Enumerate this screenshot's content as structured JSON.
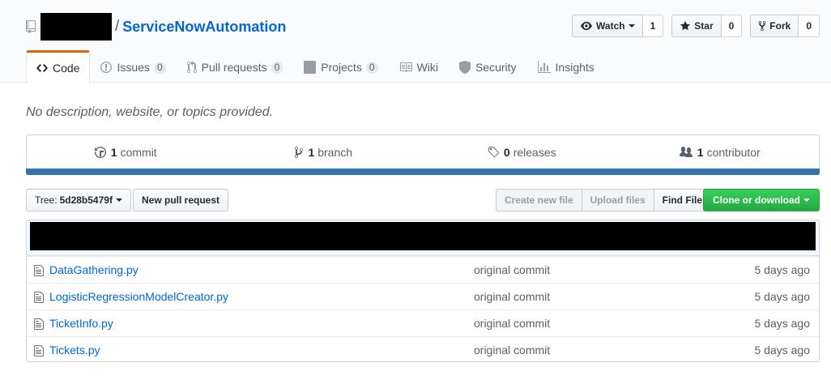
{
  "repo": {
    "name": "ServiceNowAutomation",
    "separator": "/"
  },
  "actions": {
    "watch": {
      "label": "Watch",
      "count": "1"
    },
    "star": {
      "label": "Star",
      "count": "0"
    },
    "fork": {
      "label": "Fork",
      "count": "0"
    }
  },
  "nav": {
    "tabs": [
      {
        "label": "Code",
        "icon": "code-icon",
        "selected": true
      },
      {
        "label": "Issues",
        "counter": "0",
        "icon": "issue-icon"
      },
      {
        "label": "Pull requests",
        "counter": "0",
        "icon": "pull-request-icon"
      },
      {
        "label": "Projects",
        "counter": "0",
        "icon": "project-icon"
      },
      {
        "label": "Wiki",
        "icon": "book-icon"
      },
      {
        "label": "Security",
        "icon": "shield-icon"
      },
      {
        "label": "Insights",
        "icon": "graph-icon"
      }
    ]
  },
  "description": "No description, website, or topics provided.",
  "summary": {
    "commits": {
      "num": "1",
      "label": "commit"
    },
    "branches": {
      "num": "1",
      "label": "branch"
    },
    "releases": {
      "num": "0",
      "label": "releases"
    },
    "contributors": {
      "num": "1",
      "label": "contributor"
    },
    "language_color": "#3572a5"
  },
  "file_nav": {
    "tree_label": "Tree:",
    "tree_ref": "5d28b5479f",
    "new_pr": "New pull request",
    "create_file": "Create new file",
    "upload_files": "Upload files",
    "find_file": "Find File",
    "clone": "Clone or download"
  },
  "files": [
    {
      "name": "DataGathering.py",
      "message": "original commit",
      "age": "5 days ago"
    },
    {
      "name": "LogisticRegressionModelCreator.py",
      "message": "original commit",
      "age": "5 days ago"
    },
    {
      "name": "TicketInfo.py",
      "message": "original commit",
      "age": "5 days ago"
    },
    {
      "name": "Tickets.py",
      "message": "original commit",
      "age": "5 days ago"
    }
  ],
  "colors": {
    "link": "#0366d6",
    "selected_tab_accent": "#e36209",
    "clone_button": "#28a745"
  }
}
